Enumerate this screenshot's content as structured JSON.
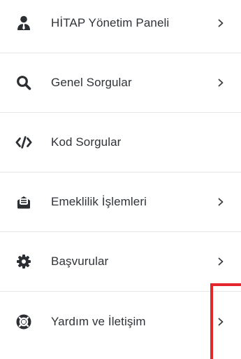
{
  "menu": {
    "items": [
      {
        "label": "HİTAP Yönetim Paneli",
        "icon": "user-tie-icon",
        "has_chevron": true
      },
      {
        "label": "Genel Sorgular",
        "icon": "search-icon",
        "has_chevron": true
      },
      {
        "label": "Kod Sorgular",
        "icon": "code-icon",
        "has_chevron": false
      },
      {
        "label": "Emeklilik İşlemleri",
        "icon": "envelope-open-text-icon",
        "has_chevron": true
      },
      {
        "label": "Başvurular",
        "icon": "cog-icon",
        "has_chevron": true
      },
      {
        "label": "Yardım ve İletişim",
        "icon": "life-ring-icon",
        "has_chevron": true
      }
    ]
  },
  "colors": {
    "icon": "#2b2f33",
    "text": "#2f3338",
    "divider": "#e6e6e6",
    "highlight": "#e3262d"
  }
}
